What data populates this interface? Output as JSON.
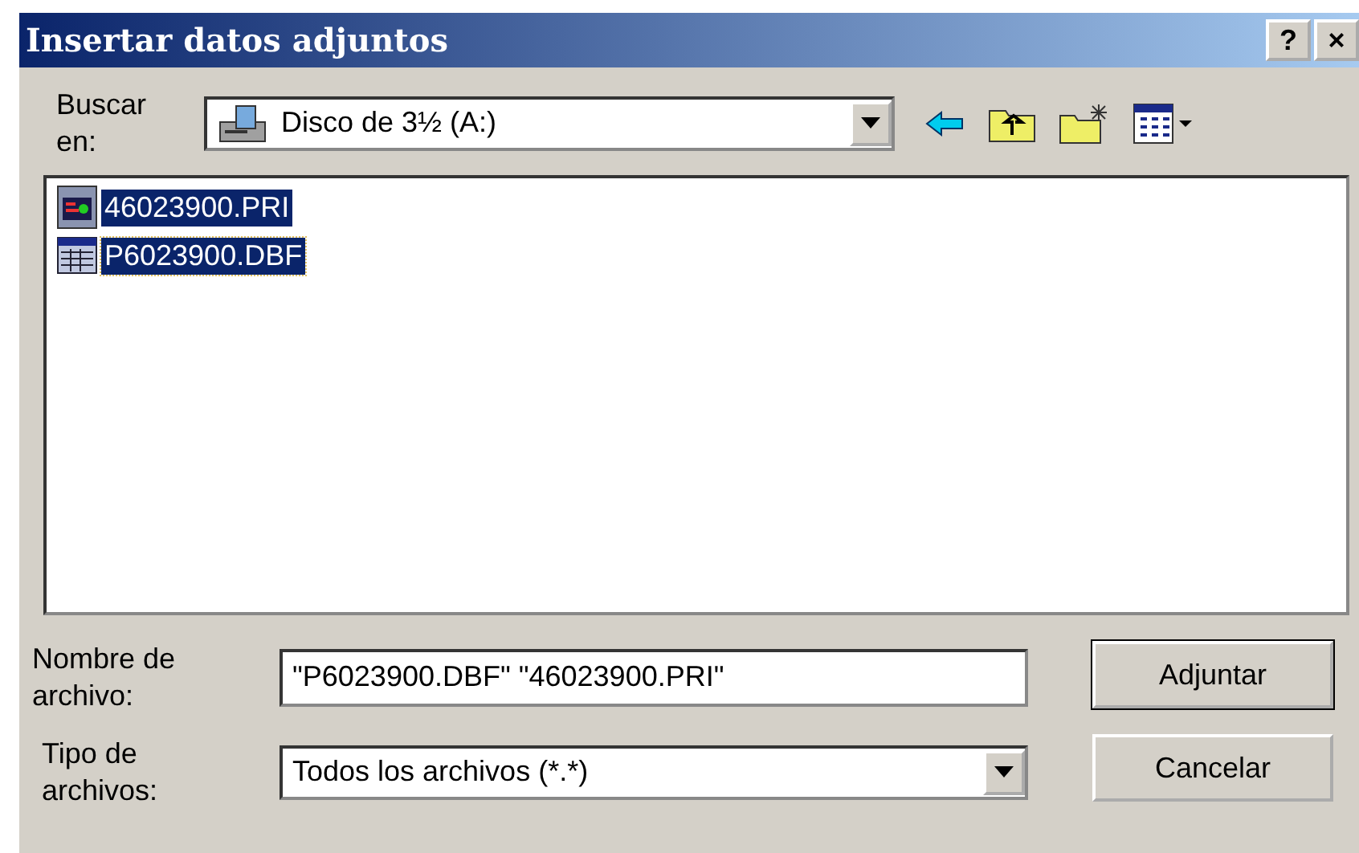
{
  "window": {
    "title": "Insertar datos adjuntos",
    "title_buttons": [
      "?",
      "×"
    ]
  },
  "look_in": {
    "label": "Buscar en:",
    "value": "Disco de 3½ (A:)"
  },
  "files": [
    {
      "name": "46023900.PRI",
      "kind": "document",
      "selected": true,
      "focused": false
    },
    {
      "name": "P6023900.DBF",
      "kind": "table",
      "selected": true,
      "focused": true
    }
  ],
  "file_name": {
    "label": "Nombre de archivo:",
    "value": "\"P6023900.DBF\" \"46023900.PRI\""
  },
  "file_type": {
    "label": "Tipo de archivos:",
    "value": "Todos los archivos (*.*)"
  },
  "buttons": [
    {
      "label": "Adjuntar",
      "default": true
    },
    {
      "label": "Cancelar",
      "default": false
    }
  ]
}
